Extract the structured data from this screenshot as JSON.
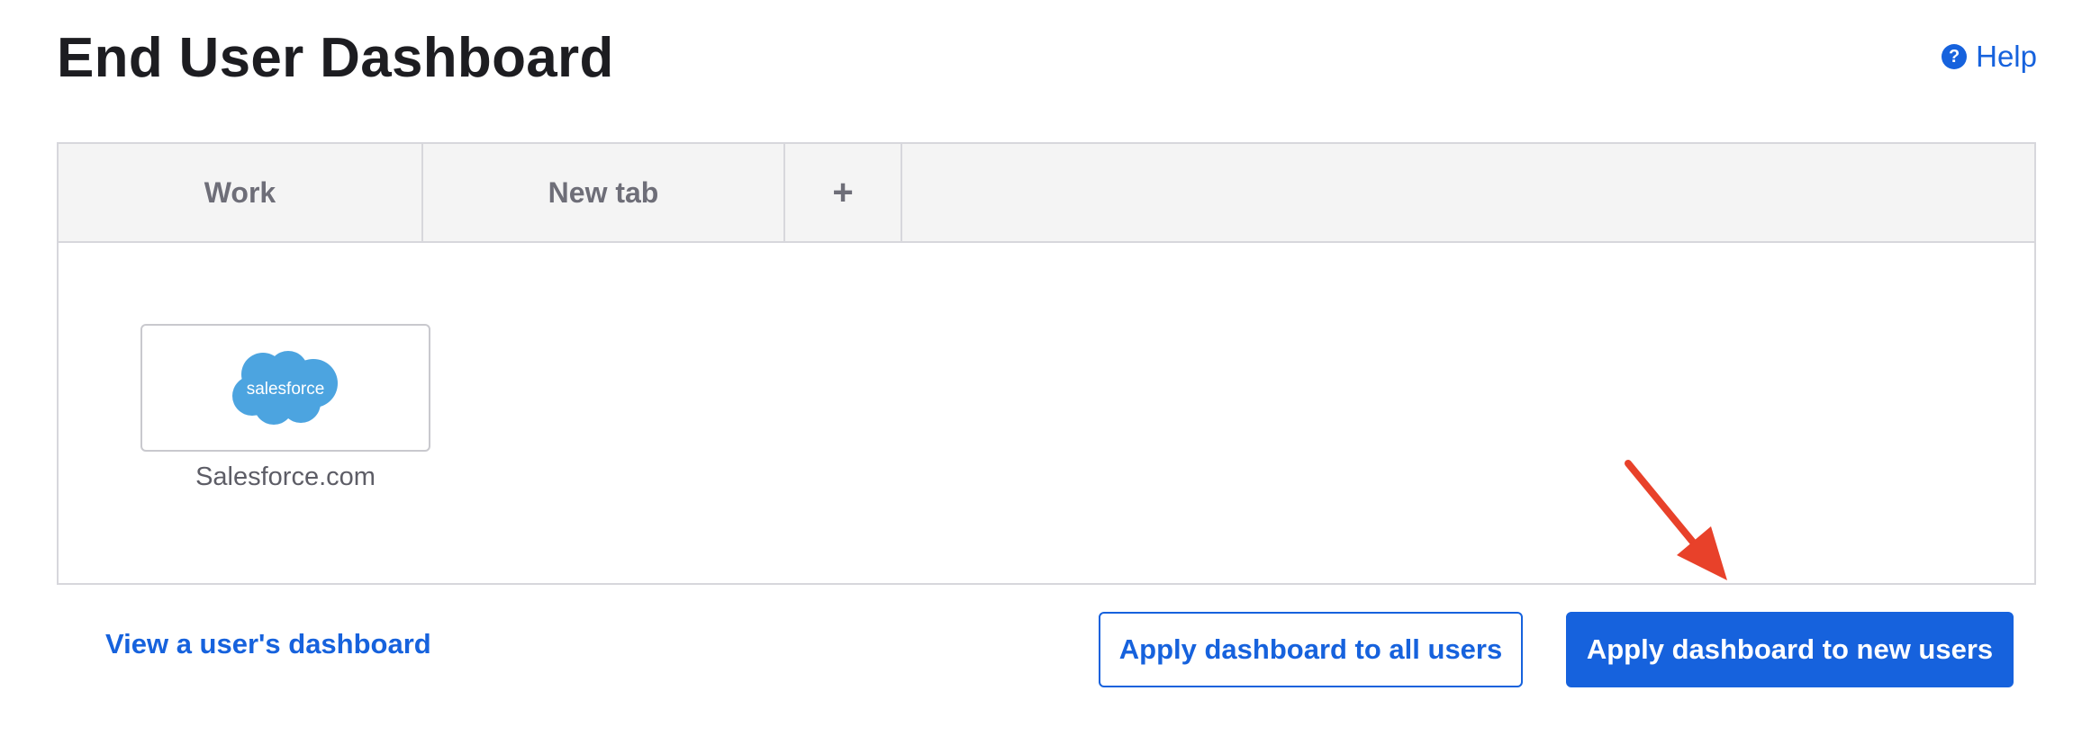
{
  "header": {
    "title": "End User Dashboard",
    "help_label": "Help",
    "help_icon": "question-circle-icon"
  },
  "tabs": [
    {
      "label": "Work"
    },
    {
      "label": "New tab"
    },
    {
      "label": "+"
    }
  ],
  "apps": [
    {
      "name": "Salesforce.com",
      "logo_text": "salesforce",
      "logo_color": "#4ca4e0"
    }
  ],
  "footer": {
    "view_dashboard_link": "View a user's dashboard",
    "apply_all_label": "Apply dashboard to all users",
    "apply_new_label": "Apply dashboard to new users"
  },
  "colors": {
    "accent": "#1662dd",
    "annotation_arrow": "#e8412a"
  }
}
